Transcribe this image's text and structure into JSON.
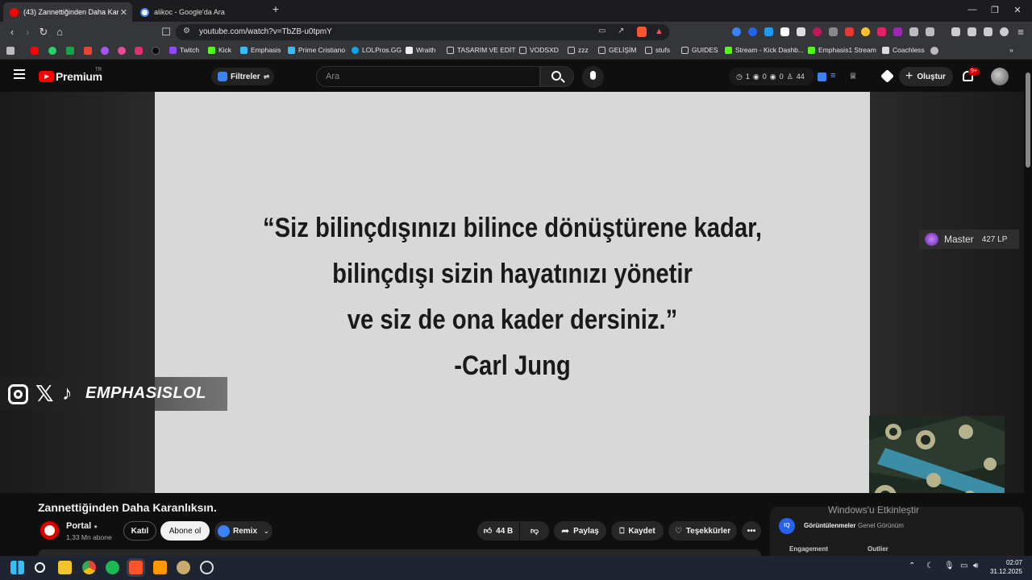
{
  "browser": {
    "tabs": [
      {
        "title": "(43) Zannettiğinden Daha Kar",
        "active": true
      },
      {
        "title": "alikoc - Google'da Ara",
        "active": false
      }
    ],
    "url": "youtube.com/watch?v=TbZB-u0tpmY",
    "bookmarks": [
      "Twitch",
      "Kick",
      "Emphasis",
      "Prime Cristiano",
      "LOLPros.GG",
      "Wraith",
      "TASARIM VE EDİT",
      "VODSXD",
      "zzz",
      "GELİŞİM",
      "stufs",
      "GUIDES",
      "Stream - Kick Dashb...",
      "Emphasis1 Stream",
      "Coachless"
    ]
  },
  "youtube": {
    "logo_text": "Premium",
    "logo_region": "TR",
    "filters_label": "Filtreler",
    "search_placeholder": "Ara",
    "stats": {
      "a": "1",
      "b": "0",
      "c": "0",
      "d": "44"
    },
    "create_label": "Oluştur",
    "notif_count": "9+"
  },
  "video": {
    "quote_lines": [
      "“Siz bilinçdışınızı bilince dönüştürene kadar,",
      "bilinçdışı sizin hayatınızı yönetir",
      "ve siz de ona kader dersiniz.”",
      "-Carl Jung"
    ],
    "rank_label": "Master",
    "rank_lp": "427 LP",
    "brand_overlay": "EMPHASISLOL",
    "title": "Zannettiğinden Daha Karanlıksın.",
    "channel": "Portal",
    "subscribers": "1,33 Mn abone",
    "join_label": "Katıl",
    "subscribe_label": "Abone ol",
    "remix_label": "Remix",
    "likes": "44 B",
    "share_label": "Paylaş",
    "save_label": "Kaydet",
    "thanks_label": "Teşekkürler"
  },
  "side_panel": {
    "tab_active": "Görüntülenmeler",
    "tab_inactive": "Genel Görünüm",
    "col1": "Engagement",
    "col2": "Outlier"
  },
  "windows_watermark": "Windows'u Etkinleştir",
  "taskbar": {
    "time": "02:07",
    "date": "31.12.2025"
  }
}
